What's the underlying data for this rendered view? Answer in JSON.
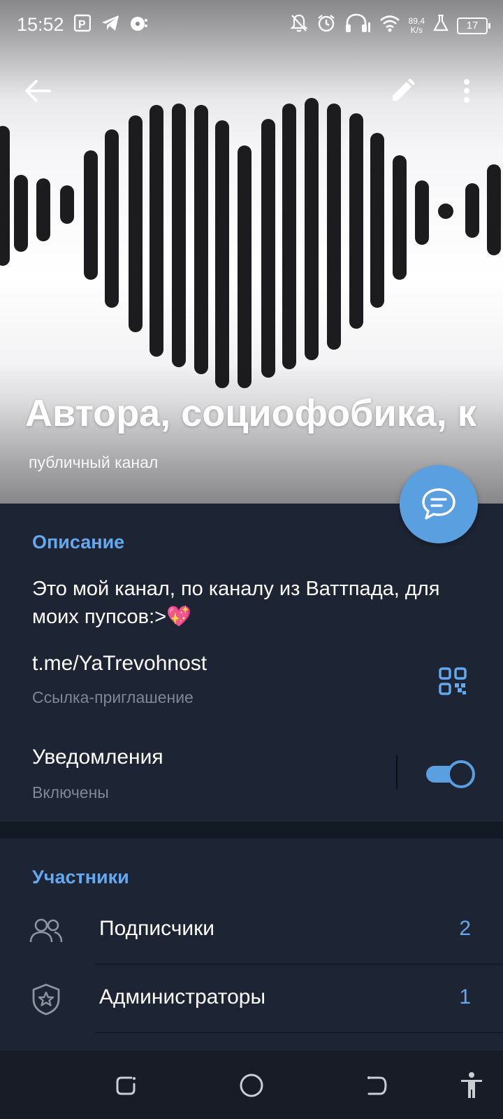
{
  "status_bar": {
    "time": "15:52",
    "net_speed_value": "89,4",
    "net_speed_unit": "K/s",
    "battery": "17",
    "icons": [
      "parking-icon",
      "telegram-icon",
      "media-icon",
      "bell-off-icon",
      "alarm-icon",
      "headphones-icon",
      "wifi-icon",
      "lab-icon"
    ]
  },
  "header": {
    "title": "Автора, социофобика, к",
    "subtitle": "публичный канал",
    "back_icon": "back-arrow-icon",
    "edit_icon": "pencil-icon",
    "more_icon": "more-vertical-icon",
    "fab_icon": "chat-bubble-icon"
  },
  "info": {
    "section_title": "Описание",
    "description": "Это мой канал, по каналу из Ваттпада, для моих пупсов:>💖",
    "link": "t.me/YaTrevohnost",
    "link_caption": "Ссылка-приглашение",
    "notifications_label": "Уведомления",
    "notifications_state": "Включены",
    "notifications_on": true
  },
  "members": {
    "section_title": "Участники",
    "rows": [
      {
        "label": "Подписчики",
        "count": "2",
        "icon": "people-icon"
      },
      {
        "label": "Администраторы",
        "count": "1",
        "icon": "shield-star-icon"
      }
    ]
  },
  "colors": {
    "accent": "#64a9f0",
    "fab": "#5a9fe0",
    "background": "#1d2433",
    "secondary_text": "#7f8794"
  },
  "nav_bar": {
    "icons": [
      "recents-icon",
      "home-icon",
      "back-icon",
      "accessibility-icon"
    ]
  }
}
